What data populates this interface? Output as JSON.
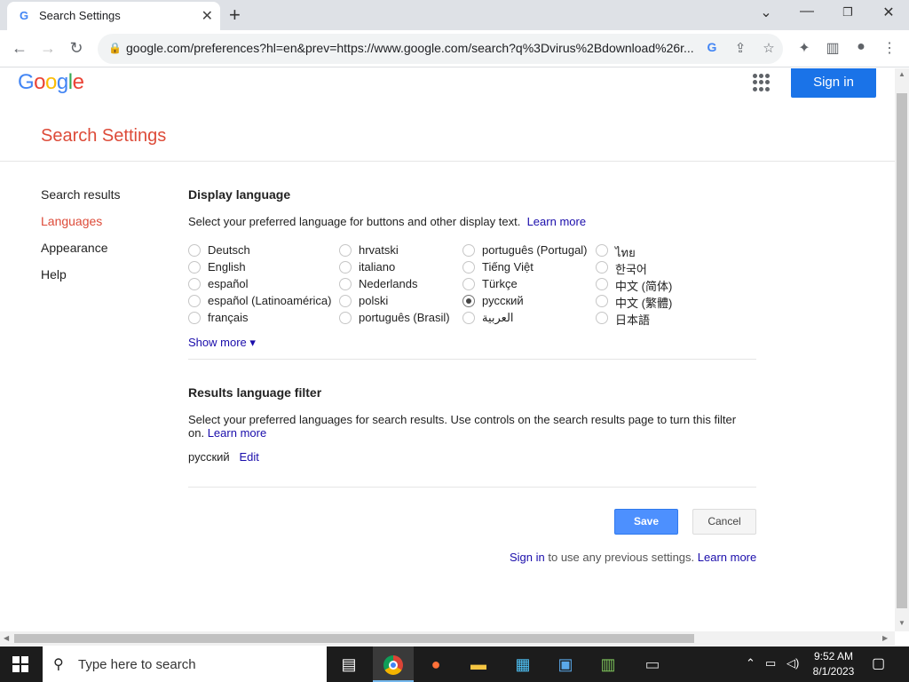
{
  "browser": {
    "tab_title": "Search Settings",
    "tab_favicon": "G",
    "url": "google.com/preferences?hl=en&prev=https://www.google.com/search?q%3Dvirus%2Bdownload%26r...",
    "minimize": "—",
    "restore": "❐",
    "close": "✕",
    "tab_list": "⌄"
  },
  "header": {
    "logo": [
      "G",
      "o",
      "o",
      "g",
      "l",
      "e"
    ],
    "logo_colors": [
      "#4285f4",
      "#ea4335",
      "#fbbc05",
      "#4285f4",
      "#34a853",
      "#ea4335"
    ],
    "sign_in": "Sign in"
  },
  "page_title": "Search Settings",
  "sidebar": {
    "items": [
      {
        "label": "Search results",
        "active": false
      },
      {
        "label": "Languages",
        "active": true
      },
      {
        "label": "Appearance",
        "active": false
      },
      {
        "label": "Help",
        "active": false
      }
    ]
  },
  "display_language": {
    "title": "Display language",
    "description": "Select your preferred language for buttons and other display text.",
    "learn_more": "Learn more",
    "columns": [
      [
        "Deutsch",
        "English",
        "español",
        "español (Latinoamérica)",
        "français"
      ],
      [
        "hrvatski",
        "italiano",
        "Nederlands",
        "polski",
        "português (Brasil)"
      ],
      [
        "português (Portugal)",
        "Tiếng Việt",
        "Türkçe",
        "русский",
        "العربية"
      ],
      [
        "ไทย",
        "한국어",
        "中文 (简体)",
        "中文 (繁體)",
        "日本語"
      ]
    ],
    "selected": "русский",
    "show_more": "Show more ▾"
  },
  "results_language": {
    "title": "Results language filter",
    "description": "Select your preferred languages for search results. Use controls on the search results page to turn this filter on.",
    "learn_more": "Learn more",
    "current": "русский",
    "edit": "Edit"
  },
  "actions": {
    "save": "Save",
    "cancel": "Cancel"
  },
  "footer": {
    "sign_in": "Sign in",
    "text": "to use any previous settings.",
    "learn_more": "Learn more"
  },
  "taskbar": {
    "search_placeholder": "Type here to search",
    "time": "9:52 AM",
    "date": "8/1/2023"
  },
  "colors": {
    "accent_red": "#dd4b39",
    "link": "#1a0dab",
    "primary_button": "#4d90fe",
    "signin_button": "#1a73e8"
  }
}
